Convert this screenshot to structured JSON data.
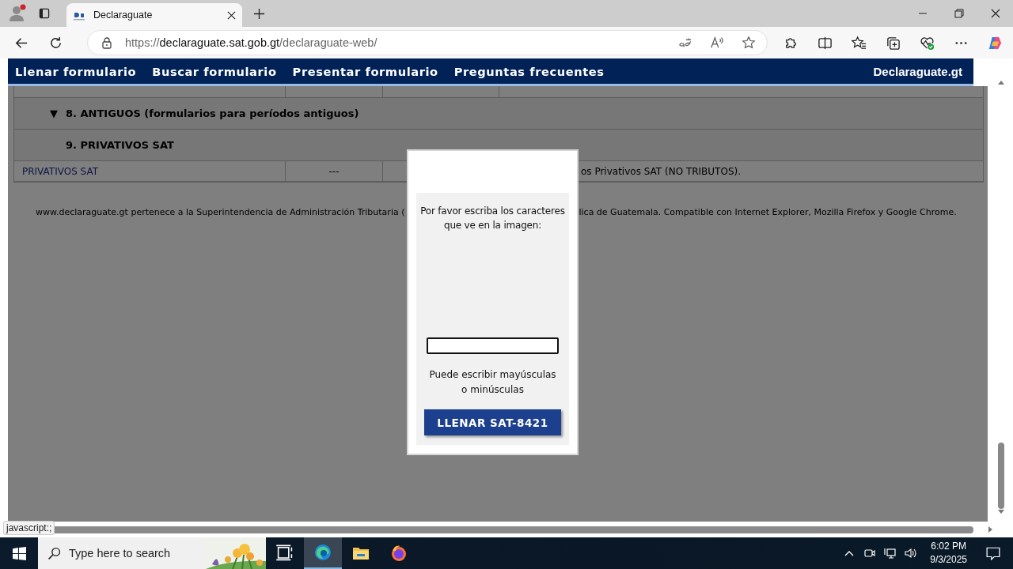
{
  "browser": {
    "tab": {
      "title": "Declaraguate",
      "selected": true
    },
    "url": {
      "scheme": "https://",
      "host": "declaraguate.sat.gob.gt",
      "path": "/declaraguate-web/"
    }
  },
  "nav": {
    "items": [
      "Llenar formulario",
      "Buscar formulario",
      "Presentar formulario",
      "Preguntas frecuentes"
    ],
    "brand": "Declaraguate.gt"
  },
  "table": {
    "sections": [
      {
        "title": "8. ANTIGUOS (formularios para períodos antiguos)",
        "marker": "▼"
      },
      {
        "title": "9. PRIVATIVOS SAT"
      }
    ],
    "rows": [
      {
        "column_1": "PRIVATIVOS SAT",
        "column_2": "---",
        "column_4": "os Privativos SAT (NO TRIBUTOS)."
      }
    ]
  },
  "footer": {
    "left": "www.declaraguate.gt pertenece a la Superintendencia de Administración Tributaria (",
    "right": "lica de Guatemala. Compatible con Internet Explorer, Mozilla Firefox y Google Chrome."
  },
  "modal": {
    "prompt": "Por favor escriba los caracteres que ve en la imagen:",
    "hint": "Puede escribir mayúsculas o minúsculas",
    "button": "LLENAR SAT-8421"
  },
  "status_tooltip": "javascript:;",
  "taskbar": {
    "search": {
      "placeholder": "Type here to search"
    },
    "apps": [
      {
        "kind": "taskview",
        "selected": false
      },
      {
        "kind": "edge",
        "selected": true
      },
      {
        "kind": "explorer",
        "selected": false
      },
      {
        "kind": "firefox",
        "selected": false
      }
    ],
    "time": "6:02 PM",
    "date": "9/3/2025"
  }
}
